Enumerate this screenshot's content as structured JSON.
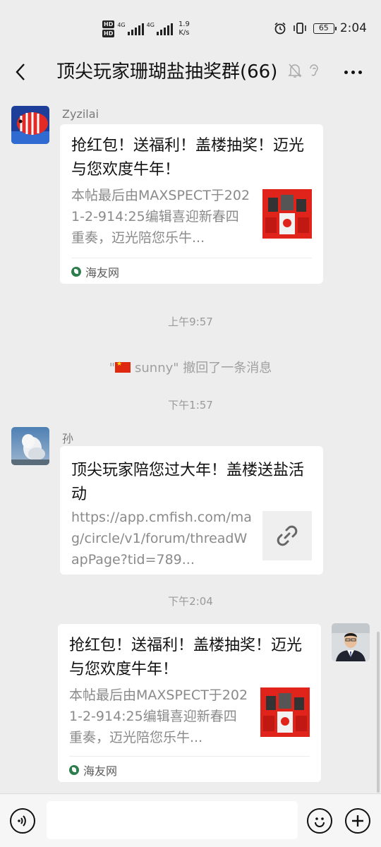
{
  "status_bar": {
    "hd1": "HD",
    "hd2": "HD",
    "sig1": "4G",
    "sig2": "4G",
    "speed_value": "1.9",
    "speed_unit": "K/s",
    "battery": "65",
    "time": "2:04",
    "icons": [
      "alarm-icon",
      "vibrate-icon",
      "battery-icon"
    ]
  },
  "nav": {
    "title": "顶尖玩家珊瑚盐抽奖群(66)",
    "icons": [
      "back-icon",
      "mute-bell-icon",
      "ear-icon",
      "more-icon"
    ]
  },
  "messages": {
    "m1": {
      "sender": "Zyzilai",
      "title": "抢红包！送福利！盖楼抽奖！迈光与您欢度牛年！",
      "desc": "本帖最后由MAXSPECT于2021-2-914:25编辑喜迎新春四重奏，迈光陪您乐牛...",
      "source": "海友网"
    },
    "t1": "上午9:57",
    "sys": {
      "quote_open": "\"",
      "name": "sunny",
      "quote_close": "\"",
      "text": " 撤回了一条消息"
    },
    "t2": "下午1:57",
    "m2": {
      "sender": "孙",
      "title": "顶尖玩家陪您过大年！盖楼送盐活动",
      "desc": "https://app.cmfish.com/mag/circle/v1/forum/threadWapPage?tid=789...",
      "thumb_icon": "link-icon"
    },
    "t3": "下午2:04",
    "m3": {
      "title": "抢红包！送福利！盖楼抽奖！迈光与您欢度牛年！",
      "desc": "本帖最后由MAXSPECT于2021-2-914:25编辑喜迎新春四重奏，迈光陪您乐牛...",
      "source": "海友网"
    }
  },
  "input_bar": {
    "placeholder": "",
    "icons": [
      "voice-icon",
      "emoji-icon",
      "plus-icon"
    ]
  },
  "colors": {
    "background": "#ededed",
    "card": "#ffffff",
    "red_envelope": "#e0241b"
  }
}
